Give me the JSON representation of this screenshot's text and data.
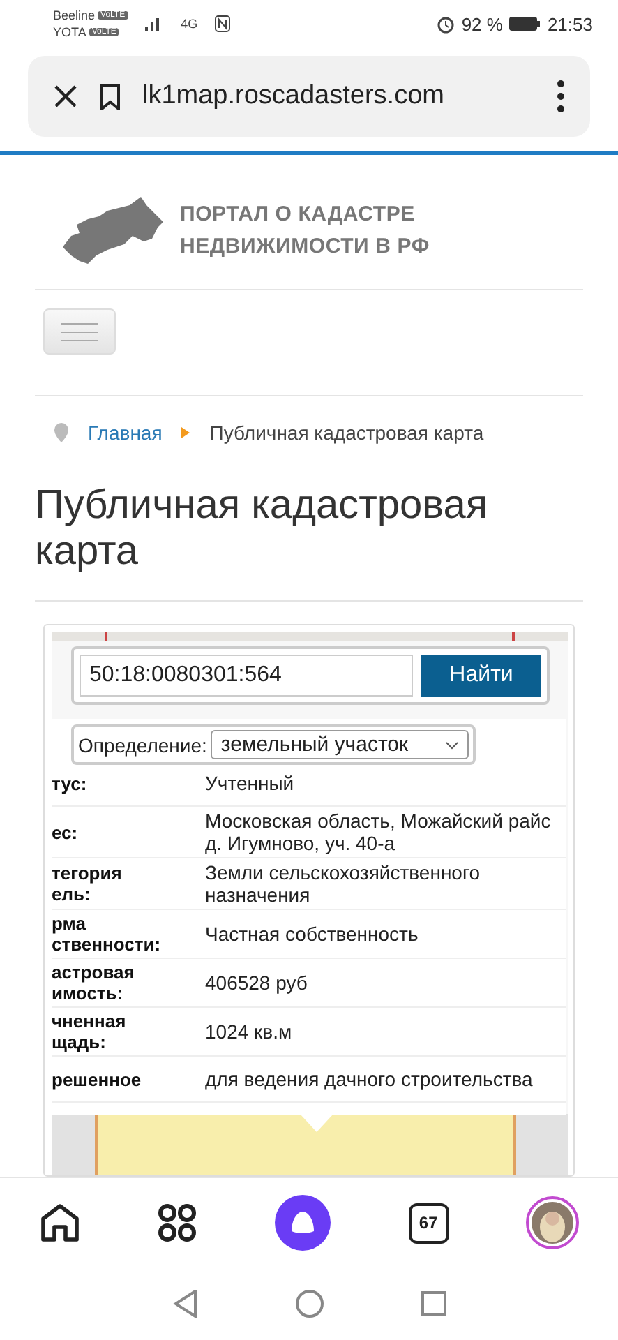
{
  "status_bar": {
    "carriers": [
      "Beeline",
      "YOTA"
    ],
    "carrier_badges": [
      "VoLTE",
      "VoLTE"
    ],
    "network": "4G",
    "battery": "92 %",
    "time": "21:53"
  },
  "browser": {
    "url": "lk1map.roscadasters.com"
  },
  "site": {
    "logo_text": [
      "ПОРТАЛ О КАДАСТРЕ",
      "НЕДВИЖИМОСТИ В РФ"
    ]
  },
  "breadcrumb": [
    {
      "label": "Главная",
      "kind": "link"
    },
    {
      "label": "Публичная кадастровая карта",
      "kind": "current"
    }
  ],
  "page_title": "Публичная кадастровая карта",
  "map": {
    "search": {
      "value": "50:18:0080301:564",
      "button": "Найти"
    },
    "popup": {
      "definition_label": "Определение:",
      "definition_value": "земельный участок",
      "rows": [
        {
          "label": [
            "тус:"
          ],
          "value": "Учтенный"
        },
        {
          "label": [
            "ес:"
          ],
          "value": "Московская область, Можайский райс д. Игумново, уч. 40-а"
        },
        {
          "label": [
            "тегория",
            "ель:"
          ],
          "value": "Земли сельскохозяйственного назначения"
        },
        {
          "label": [
            "рма",
            "ственности:"
          ],
          "value": "Частная собственность"
        },
        {
          "label": [
            "астровая",
            "имость:"
          ],
          "value": "406528 руб"
        },
        {
          "label": [
            "чненная",
            "щадь:"
          ],
          "value": "1024 кв.м"
        },
        {
          "label": [
            "решенное"
          ],
          "value": "для ведения дачного строительства"
        }
      ]
    }
  },
  "bottom_nav": {
    "tabs_count": "67"
  }
}
